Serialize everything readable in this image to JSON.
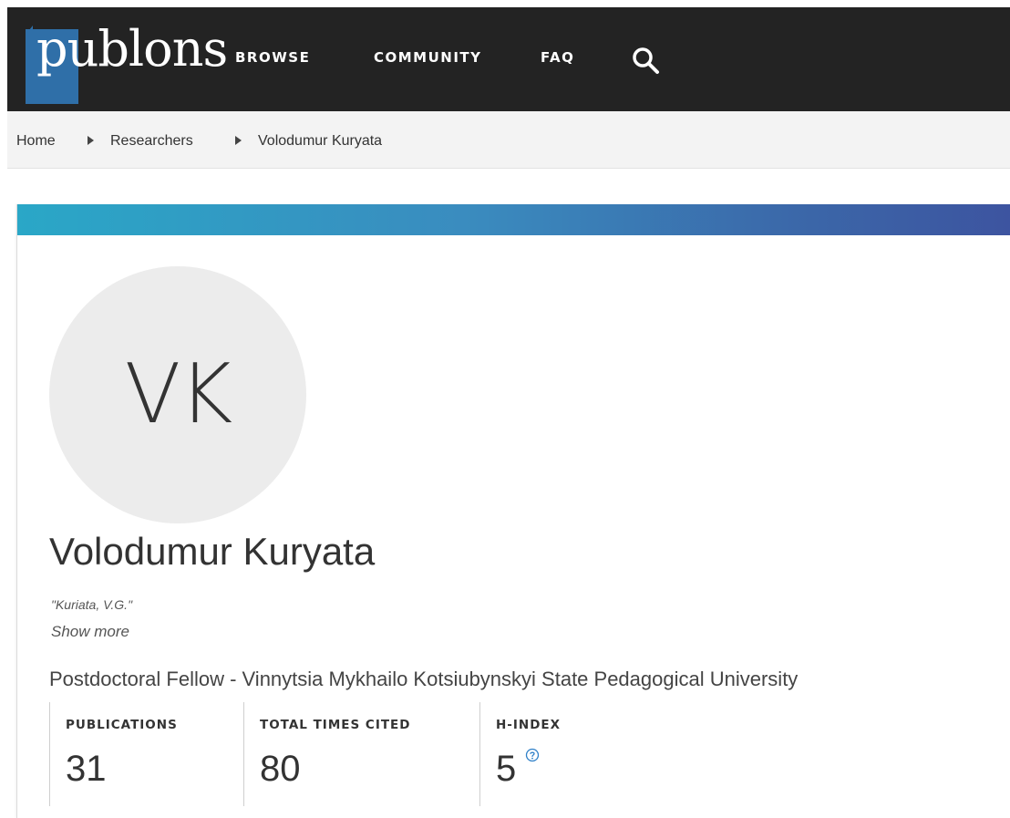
{
  "header": {
    "logo_text": "publons",
    "nav": {
      "browse": "BROWSE",
      "community": "COMMUNITY",
      "faq": "FAQ"
    },
    "search_icon": "search-icon"
  },
  "breadcrumb": {
    "home": "Home",
    "researchers": "Researchers",
    "current": "Volodumur Kuryata",
    "separator_icon": "triangle-right-icon"
  },
  "profile": {
    "initials": "VK",
    "name": "Volodumur Kuryata",
    "alias": "\"Kuriata, V.G.\"",
    "show_more": "Show more",
    "position": "Postdoctoral Fellow - Vinnytsia Mykhailo Kotsiubynskyi State Pedagogical University"
  },
  "metrics": {
    "publications": {
      "label": "PUBLICATIONS",
      "value": "31"
    },
    "times_cited": {
      "label": "TOTAL TIMES CITED",
      "value": "80"
    },
    "h_index": {
      "label": "H-INDEX",
      "value": "5",
      "help_icon": "help-circle-icon"
    }
  },
  "colors": {
    "nav_background": "#232323",
    "logo_accent": "#2f6fa8",
    "banner_start": "#2aa7c7",
    "banner_end": "#3d54a0",
    "avatar_background": "#ececec",
    "help_icon": "#2f80c8"
  }
}
